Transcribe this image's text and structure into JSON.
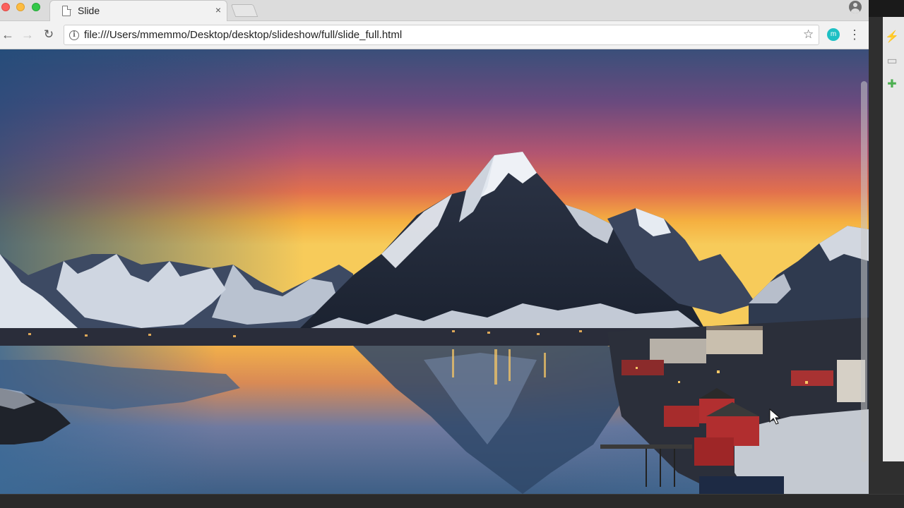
{
  "browser": {
    "tab": {
      "title": "Slide",
      "close_glyph": "×"
    },
    "address_bar": {
      "url": "file:///Users/mmemmo/Desktop/desktop/slideshow/full/slide_full.html"
    },
    "toolbar": {
      "back_glyph": "←",
      "forward_glyph": "→",
      "reload_glyph": "↻",
      "info_glyph": "i",
      "star_glyph": "☆",
      "menu_glyph": "⋮",
      "extension_label": "m"
    }
  },
  "page": {
    "image": {
      "subject": "mountain-lake-village-at-sunset",
      "sky_colors": [
        "#3a5a86",
        "#8e4a7c",
        "#d05a55",
        "#f2a43a",
        "#f7c858"
      ],
      "mountain_color": "#27303f",
      "snow_color": "#e9edf3",
      "water_color": "#4e6f92"
    }
  },
  "dock": {
    "icons": [
      "chart-icon",
      "briefcase-icon",
      "gift-icon"
    ]
  },
  "colors": {
    "tabstrip": "#dcdcdc",
    "toolbar": "#f2f2f2",
    "extension_accent": "#1ec0c4"
  }
}
